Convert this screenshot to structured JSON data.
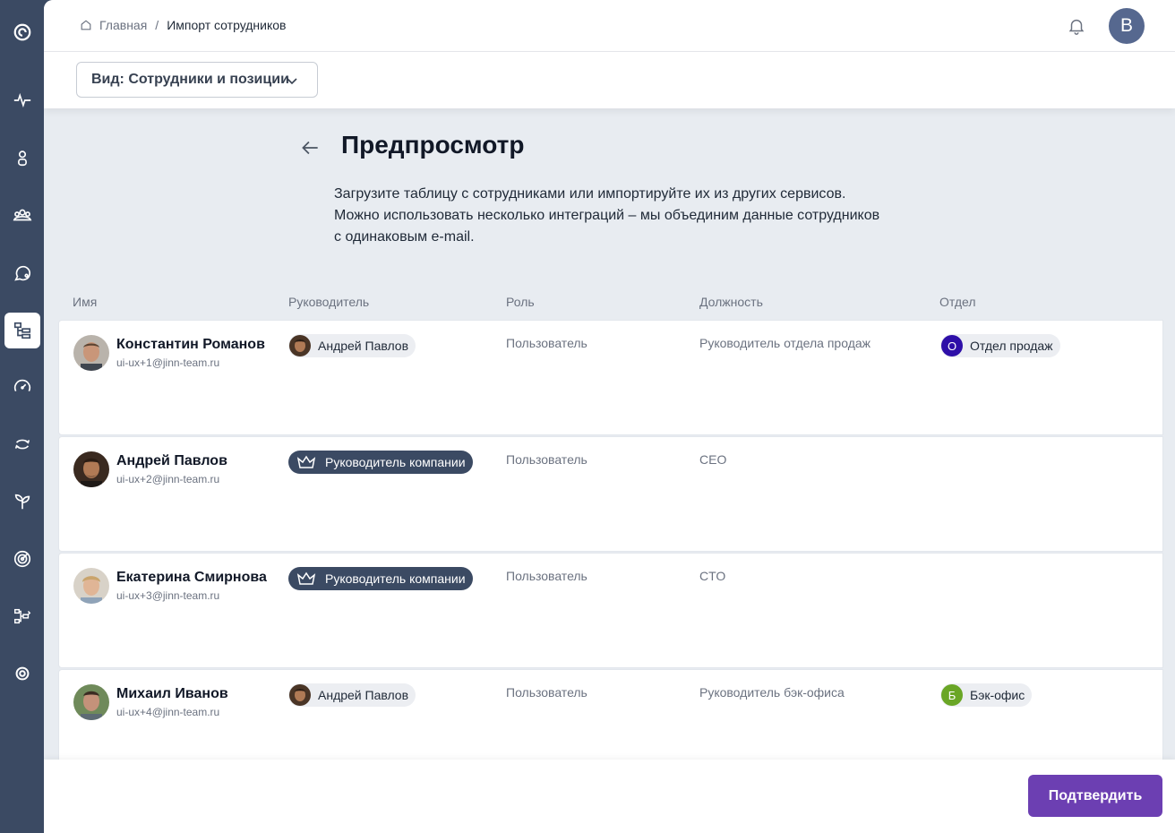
{
  "breadcrumb": {
    "home": "Главная",
    "separator": "/",
    "current": "Импорт сотрудников"
  },
  "header": {
    "avatar_letter": "В"
  },
  "view_selector": {
    "label": "Вид: Сотрудники и позиции"
  },
  "page": {
    "title": "Предпросмотр",
    "description": "Загрузите таблицу с сотрудниками или импортируйте их из других сервисов. Можно использовать несколько интеграций – мы объединим данные сотрудников с одинаковым e-mail."
  },
  "table": {
    "columns": {
      "name": "Имя",
      "manager": "Руководитель",
      "role": "Роль",
      "position": "Должность",
      "department": "Отдел"
    },
    "rows": [
      {
        "name": "Константин Романов",
        "email": "ui-ux+1@jinn-team.ru",
        "manager": "Андрей Павлов",
        "role": "Пользователь",
        "position": "Руководитель отдела продаж",
        "department": "Отдел продаж",
        "department_letter": "О"
      },
      {
        "name": "Андрей Павлов",
        "email": "ui-ux+2@jinn-team.ru",
        "manager": "Руководитель компании",
        "role": "Пользователь",
        "position": "CEO",
        "department": "",
        "department_letter": ""
      },
      {
        "name": "Екатерина Смирнова",
        "email": "ui-ux+3@jinn-team.ru",
        "manager": "Руководитель компании",
        "role": "Пользователь",
        "position": "CTO",
        "department": "",
        "department_letter": ""
      },
      {
        "name": "Михаил Иванов",
        "email": "ui-ux+4@jinn-team.ru",
        "manager": "Андрей Павлов",
        "role": "Пользователь",
        "position": "Руководитель бэк-офиса",
        "department": "Бэк-офис",
        "department_letter": "Б"
      }
    ]
  },
  "footer": {
    "confirm_label": "Подтвердить"
  },
  "colors": {
    "sidebar": "#3b4a63",
    "accent": "#6c3fb2",
    "dept_sales": "#2e0fa8",
    "dept_backoffice": "#6aa626"
  }
}
